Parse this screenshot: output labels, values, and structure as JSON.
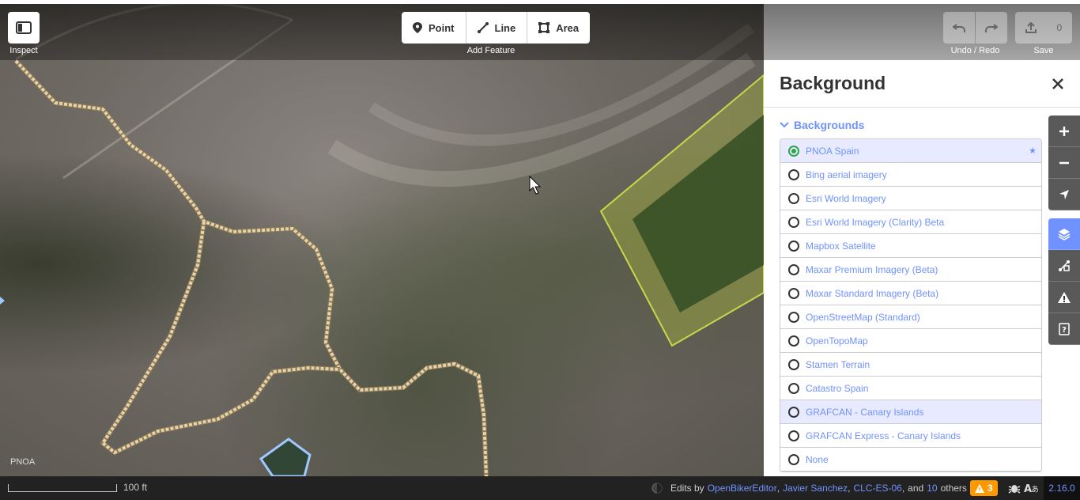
{
  "toolbar": {
    "inspect_label": "Inspect",
    "add_feature_label": "Add Feature",
    "modes": [
      {
        "label": "Point",
        "icon": "point-icon"
      },
      {
        "label": "Line",
        "icon": "line-icon"
      },
      {
        "label": "Area",
        "icon": "area-icon"
      }
    ],
    "undo_redo_label": "Undo / Redo",
    "save_label": "Save",
    "save_count": "0"
  },
  "map": {
    "imagery_attribution": "PNOA"
  },
  "panel": {
    "title": "Background",
    "section_title": "Backgrounds",
    "backgrounds": [
      {
        "name": "PNOA Spain",
        "selected": true,
        "starred": true
      },
      {
        "name": "Bing aerial imagery",
        "selected": false
      },
      {
        "name": "Esri World Imagery",
        "selected": false
      },
      {
        "name": "Esri World Imagery (Clarity) Beta",
        "selected": false
      },
      {
        "name": "Mapbox Satellite",
        "selected": false
      },
      {
        "name": "Maxar Premium Imagery (Beta)",
        "selected": false
      },
      {
        "name": "Maxar Standard Imagery (Beta)",
        "selected": false
      },
      {
        "name": "OpenStreetMap (Standard)",
        "selected": false
      },
      {
        "name": "OpenTopoMap",
        "selected": false
      },
      {
        "name": "Stamen Terrain",
        "selected": false
      },
      {
        "name": "Catastro Spain",
        "selected": false
      },
      {
        "name": "GRAFCAN - Canary Islands",
        "selected": false,
        "hover": true
      },
      {
        "name": "GRAFCAN Express - Canary Islands",
        "selected": false
      },
      {
        "name": "None",
        "selected": false
      }
    ]
  },
  "footer": {
    "scale_label": "100 ft",
    "edits_prefix": "Edits by",
    "contributors": [
      "OpenBikerEditor",
      "Javier Sanchez",
      "CLC-ES-06"
    ],
    "and_text": "and",
    "others_count": "10",
    "others_text": "others",
    "issues_count": "3",
    "version": "2.16.0"
  },
  "colors": {
    "accent": "#7092ff",
    "selected": "#2ca64b",
    "warning": "#ff9900",
    "path": "#e8d2a8",
    "area_fill": "#b8c93a"
  }
}
